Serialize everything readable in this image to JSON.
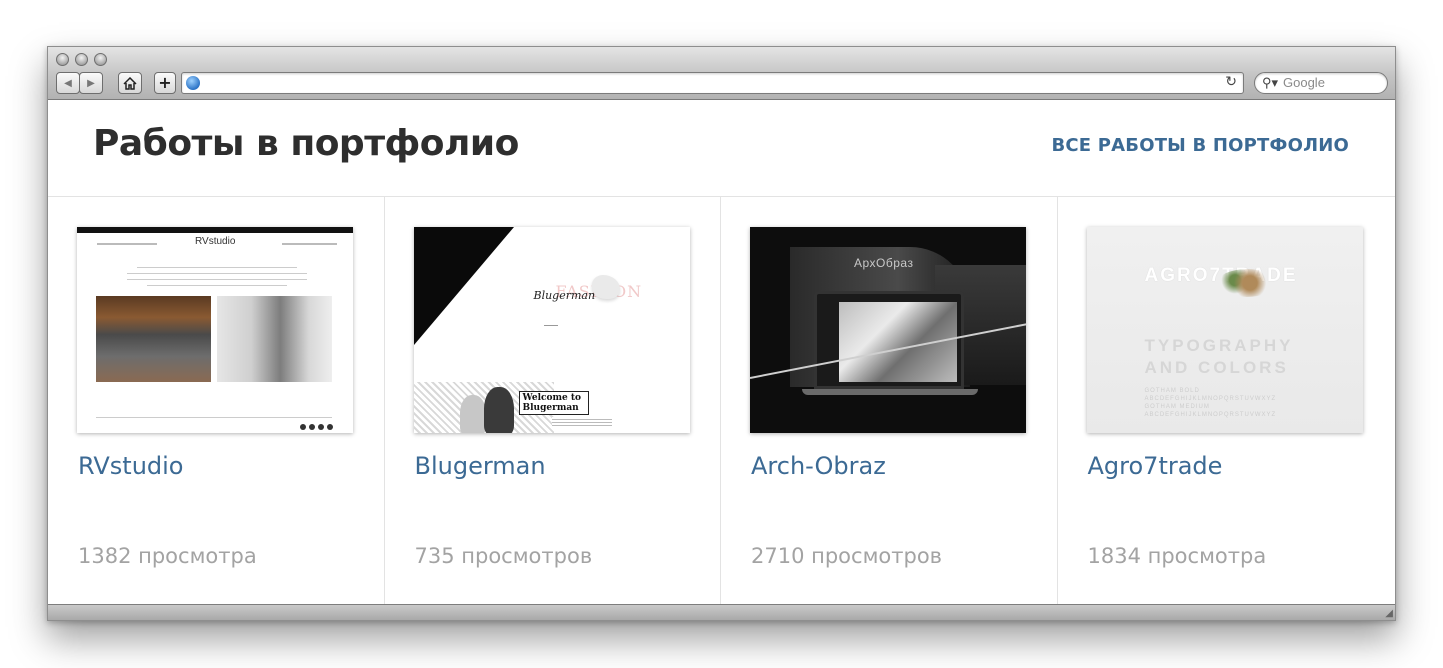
{
  "browser": {
    "search_placeholder": "Google"
  },
  "page": {
    "title": "Работы в портфолио",
    "all_link": "ВСЕ РАБОТЫ В ПОРТФОЛИО"
  },
  "cards": [
    {
      "title": "RVstudio",
      "views": "1382 просмотра",
      "thumb_logo": "RVstudio"
    },
    {
      "title": "Blugerman",
      "views": "735 просмотров",
      "thumb_text": "Welcome to Blugerman"
    },
    {
      "title": "Arch-Obraz",
      "views": "2710 просмотров",
      "thumb_logo": "АрхОбраз"
    },
    {
      "title": "Agro7trade",
      "views": "1834 просмотра",
      "thumb_logo": "AGRO7TRADE",
      "thumb_text": "TYPOGRAPHY AND COLORS"
    }
  ]
}
